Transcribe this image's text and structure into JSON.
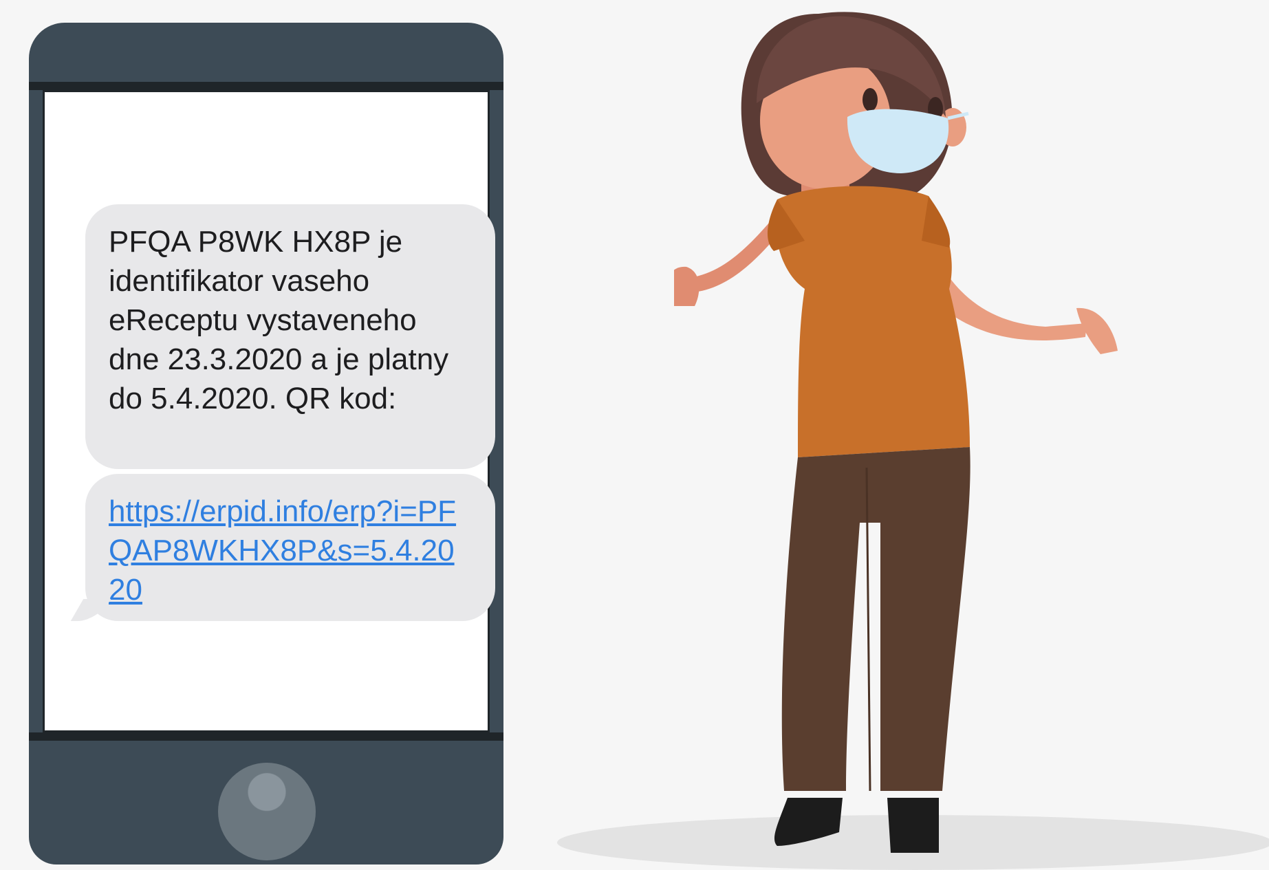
{
  "sms": {
    "message_text": "PFQA P8WK HX8P je identifikator vaseho eReceptu vystaveneho dne 23.3.2020 a je platny do 5.4.2020. QR kod:",
    "link_text": "https://erpid.info/erp?i=PFQAP8WKHX8P&s=5.4.2020"
  },
  "colors": {
    "background": "#f6f6f6",
    "phone_body": "#3d4b56",
    "bubble": "#e8e8ea",
    "link": "#2f7fe0",
    "shirt": "#c8702a",
    "pants": "#5a3e2f",
    "mask": "#cfe9f7"
  },
  "icons": [
    "phone-home-button",
    "woman-with-face-mask-illustration"
  ]
}
